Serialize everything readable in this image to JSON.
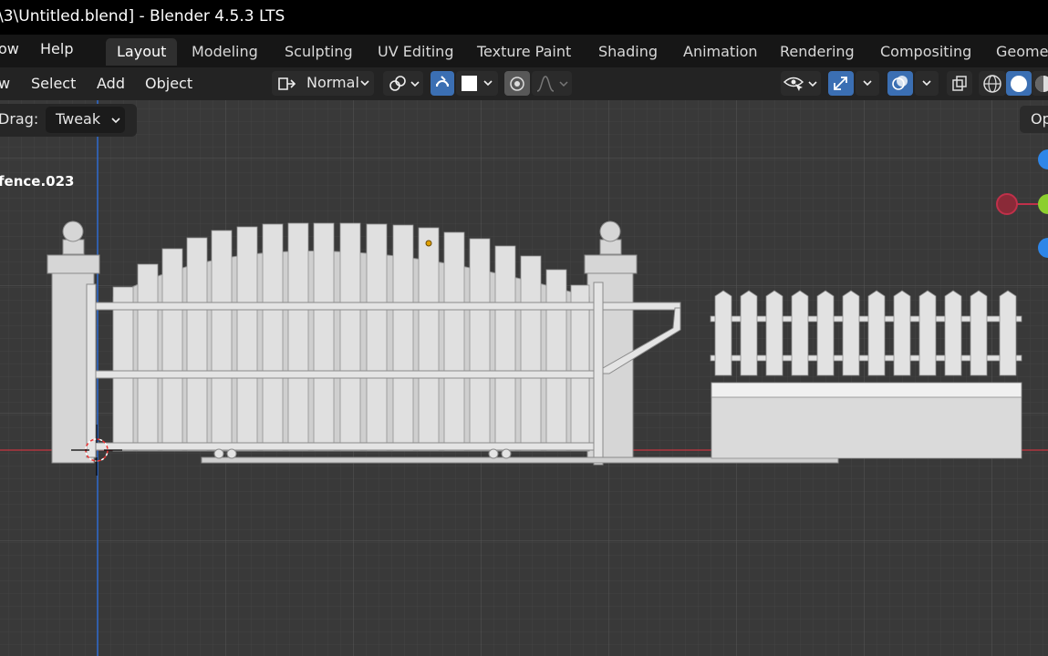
{
  "window": {
    "title": "\\3\\Untitled.blend] - Blender 4.5.3 LTS"
  },
  "menubar": {
    "items": [
      "ow",
      "Help"
    ],
    "workspace_tabs": [
      "Layout",
      "Modeling",
      "Sculpting",
      "UV Editing",
      "Texture Paint",
      "Shading",
      "Animation",
      "Rendering",
      "Compositing",
      "Geomet"
    ],
    "active_tab": "Layout"
  },
  "header": {
    "menus": [
      "w",
      "Select",
      "Add",
      "Object"
    ],
    "mode": "Normal"
  },
  "tool_settings": {
    "drag_label": "Drag:",
    "drag_value": "Tweak",
    "options_label": "Op"
  },
  "viewport": {
    "object_name": "fence.023"
  },
  "colors": {
    "accent": "#3b6fb3",
    "x_axis": "#c0304a",
    "y_axis": "#8ccf2d",
    "z_axis": "#2e86e8"
  }
}
